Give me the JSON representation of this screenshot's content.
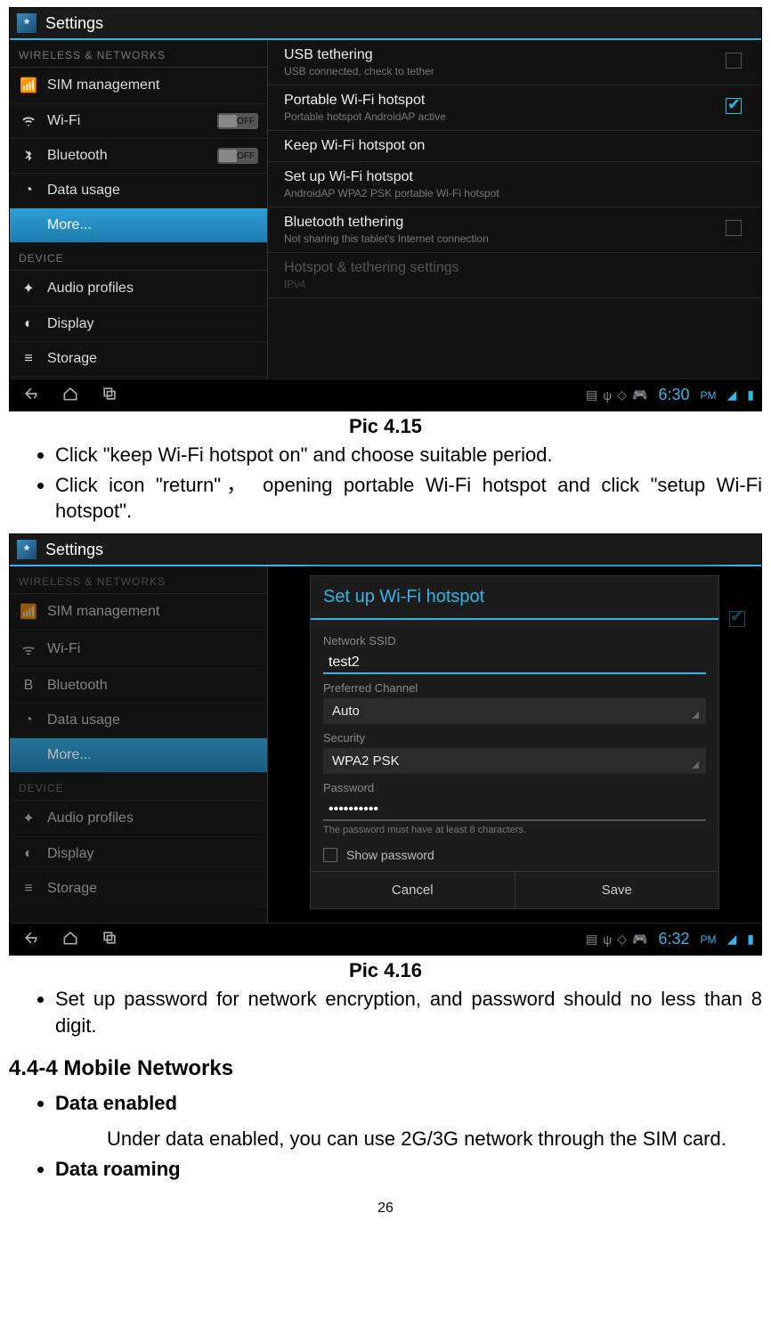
{
  "screenshot1": {
    "title": "Settings",
    "sidebar": {
      "section1": "WIRELESS & NETWORKS",
      "sim": "SIM management",
      "wifi": "Wi-Fi",
      "bt": "Bluetooth",
      "data": "Data usage",
      "more": "More...",
      "off": "OFF",
      "section2": "DEVICE",
      "audio": "Audio profiles",
      "display": "Display",
      "storage": "Storage"
    },
    "main": {
      "usb_t": "USB tethering",
      "usb_s": "USB connected, check to tether",
      "pwh_t": "Portable Wi-Fi hotspot",
      "pwh_s": "Portable hotspot AndroidAP active",
      "keep_t": "Keep Wi-Fi hotspot on",
      "setup_t": "Set up Wi-Fi hotspot",
      "setup_s": "AndroidAP WPA2 PSK portable Wi-Fi hotspot",
      "btt_t": "Bluetooth tethering",
      "btt_s": "Not sharing this tablet's Internet connection",
      "dis_t": "Hotspot & tethering settings",
      "dis_s": "IPv4"
    },
    "clock": "6:30",
    "ampm": "PM"
  },
  "caption1": "Pic 4.15",
  "bullets1": {
    "b1": "Click \"keep Wi-Fi hotspot on\" and choose suitable period.",
    "b2": "Click icon \"return\"， opening portable Wi-Fi hotspot and click \"setup Wi-Fi hotspot\"."
  },
  "screenshot2": {
    "title": "Settings",
    "dialog": {
      "title": "Set up Wi-Fi hotspot",
      "ssid_label": "Network SSID",
      "ssid_value": "test2",
      "channel_label": "Preferred Channel",
      "channel_value": "Auto",
      "security_label": "Security",
      "security_value": "WPA2 PSK",
      "password_label": "Password",
      "password_value": "••••••••••",
      "hint": "The password must have at least 8 characters.",
      "show_pw": "Show password",
      "cancel": "Cancel",
      "save": "Save"
    },
    "clock": "6:32",
    "ampm": "PM"
  },
  "caption2": "Pic 4.16",
  "bullets2": {
    "b1": "Set up password for network encryption, and password should no less than 8 digit."
  },
  "section": {
    "heading": "4.4-4 Mobile Networks",
    "data_enabled": "Data enabled",
    "data_enabled_text": "Under data enabled, you can use 2G/3G network through the SIM card.",
    "data_roaming": "Data roaming"
  },
  "page_number": "26"
}
